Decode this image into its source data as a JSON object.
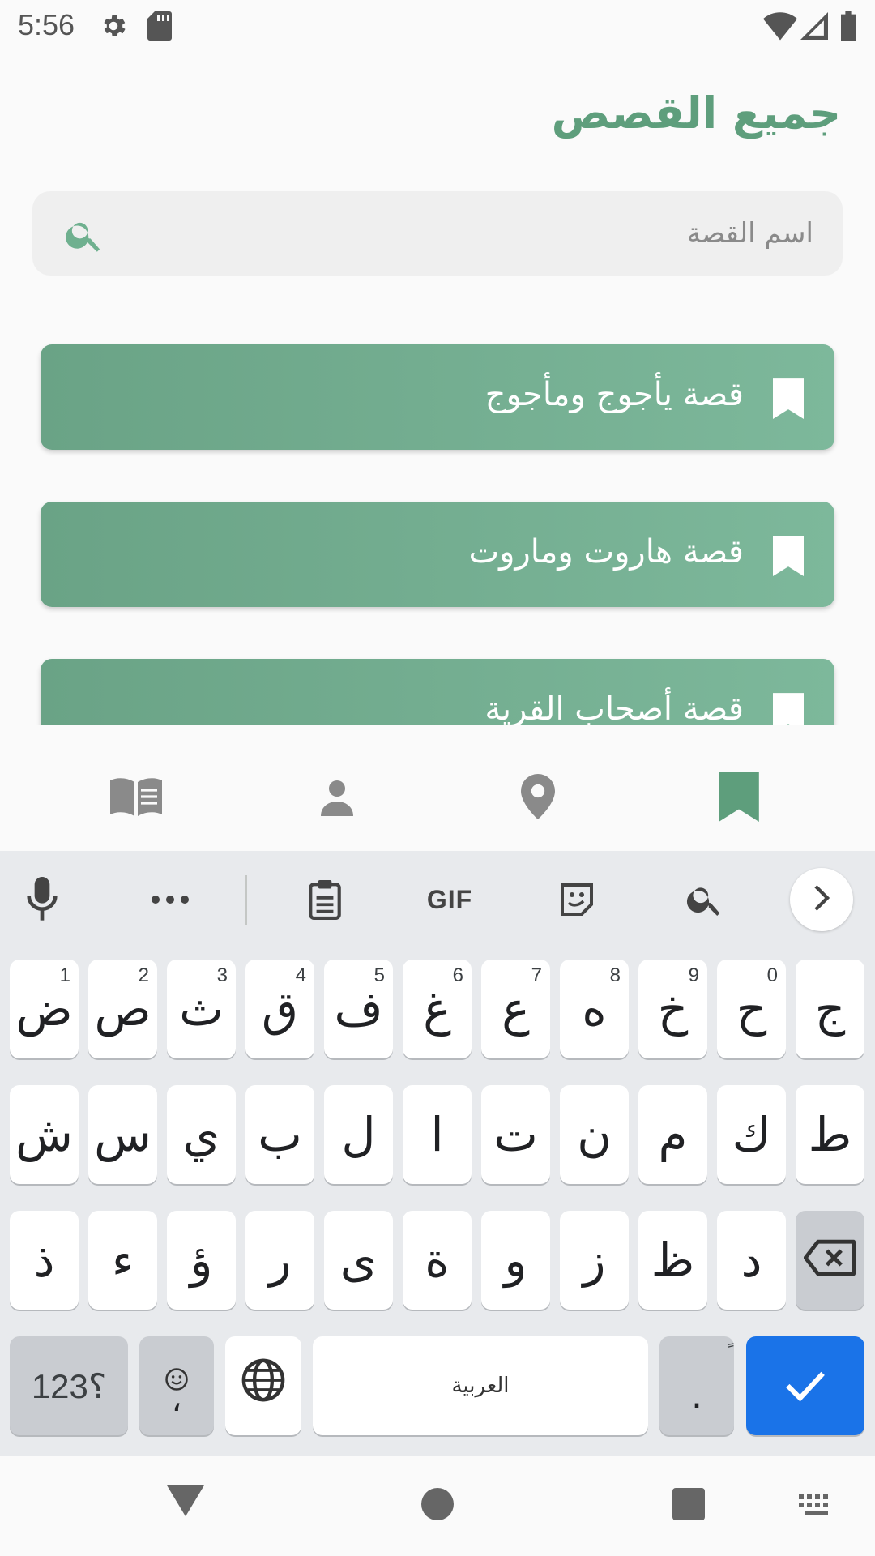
{
  "status_bar": {
    "time": "5:56",
    "icons": [
      "settings-icon",
      "sd-card-icon",
      "wifi-icon",
      "signal-icon",
      "battery-icon"
    ]
  },
  "header": {
    "title": "جميع القصص"
  },
  "search": {
    "placeholder": "اسم القصة",
    "value": ""
  },
  "stories": [
    {
      "title": "قصة يأجوج ومأجوج",
      "icon": "bookmark-icon"
    },
    {
      "title": "قصة هاروت وماروت",
      "icon": "bookmark-icon"
    },
    {
      "title": "قصة أصحاب القرية",
      "icon": "bookmark-icon"
    }
  ],
  "bottom_nav": {
    "items": [
      "book-icon",
      "person-icon",
      "location-icon",
      "bookmark-icon"
    ],
    "active": "bookmark-icon"
  },
  "keyboard": {
    "toolbar": {
      "gif_label": "GIF"
    },
    "row1": [
      {
        "char": "ض",
        "hint": "1"
      },
      {
        "char": "ص",
        "hint": "2"
      },
      {
        "char": "ث",
        "hint": "3"
      },
      {
        "char": "ق",
        "hint": "4"
      },
      {
        "char": "ف",
        "hint": "5"
      },
      {
        "char": "غ",
        "hint": "6"
      },
      {
        "char": "ع",
        "hint": "7"
      },
      {
        "char": "ه",
        "hint": "8"
      },
      {
        "char": "خ",
        "hint": "9"
      },
      {
        "char": "ح",
        "hint": "0"
      },
      {
        "char": "ج",
        "hint": ""
      }
    ],
    "row2": [
      "ش",
      "س",
      "ي",
      "ب",
      "ل",
      "ا",
      "ت",
      "ن",
      "م",
      "ك",
      "ط"
    ],
    "row3": [
      "ذ",
      "ء",
      "ؤ",
      "ر",
      "ى",
      "ة",
      "و",
      "ز",
      "ظ",
      "د"
    ],
    "row4": {
      "symbols_label": "؟123",
      "emoji_comma": "،",
      "space_label": "العربية",
      "period": ".",
      "period_hint": "ً"
    }
  },
  "colors": {
    "accent": "#5e9e7c",
    "card_start": "#6aa386",
    "card_end": "#7db89b",
    "keyboard_bg": "#e8eaed",
    "enter_key": "#1a73e8"
  }
}
